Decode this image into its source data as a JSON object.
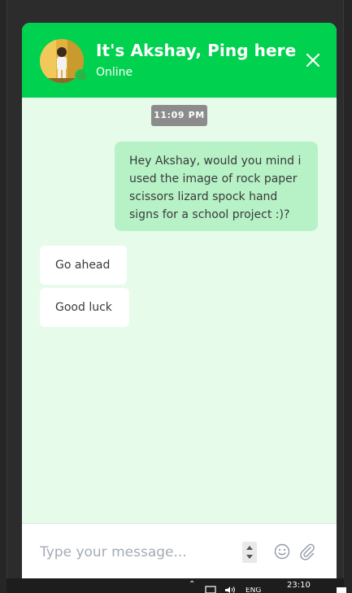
{
  "header": {
    "title": "It's Akshay, Ping here",
    "status": "Online",
    "avatar_icon": "profile-photo",
    "close_icon": "close-icon"
  },
  "conversation": {
    "timestamp": "11:09 PM",
    "outgoing": {
      "lines": [
        "Hey Akshay, would you mind i",
        "used the image of rock paper",
        "scissors lizard spock hand",
        "signs for a school project :)?"
      ]
    },
    "incoming": [
      {
        "text": "Go ahead"
      },
      {
        "text": "Good luck"
      }
    ]
  },
  "composer": {
    "placeholder": "Type your message...",
    "value": "",
    "emoji_icon": "smiley-icon",
    "attach_icon": "paperclip-icon"
  },
  "taskbar": {
    "language": "ENG",
    "clock": "23:10"
  },
  "colors": {
    "header_green": "#00d14e",
    "body_mint": "#e6fbea",
    "outgoing_bubble": "#b6f2c6",
    "incoming_bubble": "#ffffff",
    "timestamp_chip": "#8c8c8c",
    "presence": "#2fb14a"
  }
}
